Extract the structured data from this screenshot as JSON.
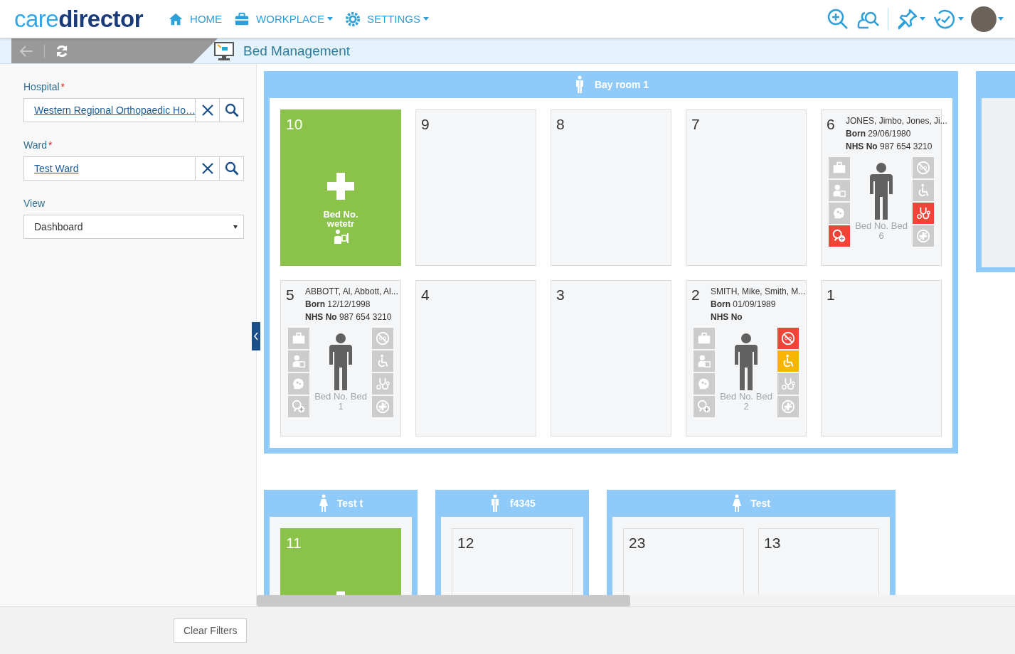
{
  "header": {
    "logo": {
      "light": "care",
      "dark": "director"
    },
    "nav": [
      {
        "kind": "home",
        "label": "HOME",
        "dropdown": false
      },
      {
        "kind": "workplace",
        "label": "WORKPLACE",
        "dropdown": true
      },
      {
        "kind": "settings",
        "label": "SETTINGS",
        "dropdown": true
      }
    ]
  },
  "page_title": "Bed Management",
  "filters": [
    {
      "kind": "lookup",
      "label": "Hospital",
      "required_mark": "*",
      "value": "Western Regional Orthopaedic Ho…"
    },
    {
      "kind": "lookup",
      "label": "Ward",
      "required_mark": "*",
      "value": "Test Ward"
    },
    {
      "kind": "select",
      "label": "View",
      "value": "Dashboard"
    }
  ],
  "clear_button": "Clear Filters",
  "bay_rows": [
    [
      {
        "name": "Bay room 1",
        "kind": "mixed",
        "beds": [
          {
            "number": "10",
            "kind": "available",
            "label": "Bed No.",
            "name": "wetetr"
          },
          {
            "number": "9",
            "kind": "empty"
          },
          {
            "number": "8",
            "kind": "empty"
          },
          {
            "number": "7",
            "kind": "empty"
          },
          {
            "number": "6",
            "kind": "occupied",
            "patient": "JONES, Jimbo, Jones, Ji...",
            "born_label": "Born",
            "dob": "29/06/1980",
            "nhs_label": "NHS No",
            "nhs": "987 654 3210",
            "bed_label": "Bed No. Bed",
            "bed_number": "6",
            "flags": [
              {
                "kind": "briefcase",
                "color": "#cccccc"
              },
              {
                "kind": "person",
                "color": "#cccccc"
              },
              {
                "kind": "head",
                "color": "#cccccc"
              },
              {
                "kind": "magnifier",
                "color": "#f04438"
              },
              {
                "kind": "prohibited",
                "color": "#cccccc"
              },
              {
                "kind": "wheelchair",
                "color": "#cccccc"
              },
              {
                "kind": "stethoscope",
                "color": "#f04438"
              },
              {
                "kind": "noplus",
                "color": "#cccccc"
              }
            ]
          },
          {
            "number": "5",
            "kind": "occupied",
            "patient": "ABBOTT, Al, Abbott, Al...",
            "born_label": "Born",
            "dob": "12/12/1998",
            "nhs_label": "NHS No",
            "nhs": "987 654 3210",
            "bed_label": "Bed No. Bed",
            "bed_number": "1",
            "flags": [
              {
                "kind": "briefcase",
                "color": "#cccccc"
              },
              {
                "kind": "person",
                "color": "#cccccc"
              },
              {
                "kind": "head",
                "color": "#cccccc"
              },
              {
                "kind": "magnifier",
                "color": "#cccccc"
              },
              {
                "kind": "prohibited",
                "color": "#cccccc"
              },
              {
                "kind": "wheelchair",
                "color": "#cccccc"
              },
              {
                "kind": "stethoscope",
                "color": "#cccccc"
              },
              {
                "kind": "noplus",
                "color": "#cccccc"
              }
            ]
          },
          {
            "number": "4",
            "kind": "empty"
          },
          {
            "number": "3",
            "kind": "empty"
          },
          {
            "number": "2",
            "kind": "occupied",
            "patient": "SMITH, Mike, Smith, M...",
            "born_label": "Born",
            "dob": "01/09/1989",
            "nhs_label": "NHS No",
            "bed_label": "Bed No. Bed",
            "bed_number": "2",
            "flags": [
              {
                "kind": "briefcase",
                "color": "#cccccc"
              },
              {
                "kind": "person",
                "color": "#cccccc"
              },
              {
                "kind": "head",
                "color": "#cccccc"
              },
              {
                "kind": "magnifier",
                "color": "#cccccc"
              },
              {
                "kind": "prohibited",
                "color": "#f04438"
              },
              {
                "kind": "wheelchair",
                "color": "#f7b500"
              },
              {
                "kind": "stethoscope",
                "color": "#cccccc"
              },
              {
                "kind": "noplus",
                "color": "#cccccc"
              }
            ]
          },
          {
            "number": "1",
            "kind": "empty"
          }
        ]
      }
    ],
    [
      {
        "name": "Test t",
        "kind": "female",
        "beds": [
          {
            "number": "11",
            "kind": "available"
          }
        ]
      },
      {
        "name": "f4345",
        "kind": "mixed",
        "beds": [
          {
            "number": "12",
            "kind": "empty"
          }
        ]
      },
      {
        "name": "Test",
        "kind": "female",
        "beds": [
          {
            "number": "23",
            "kind": "empty"
          },
          {
            "number": "13",
            "kind": "empty"
          }
        ]
      }
    ]
  ]
}
